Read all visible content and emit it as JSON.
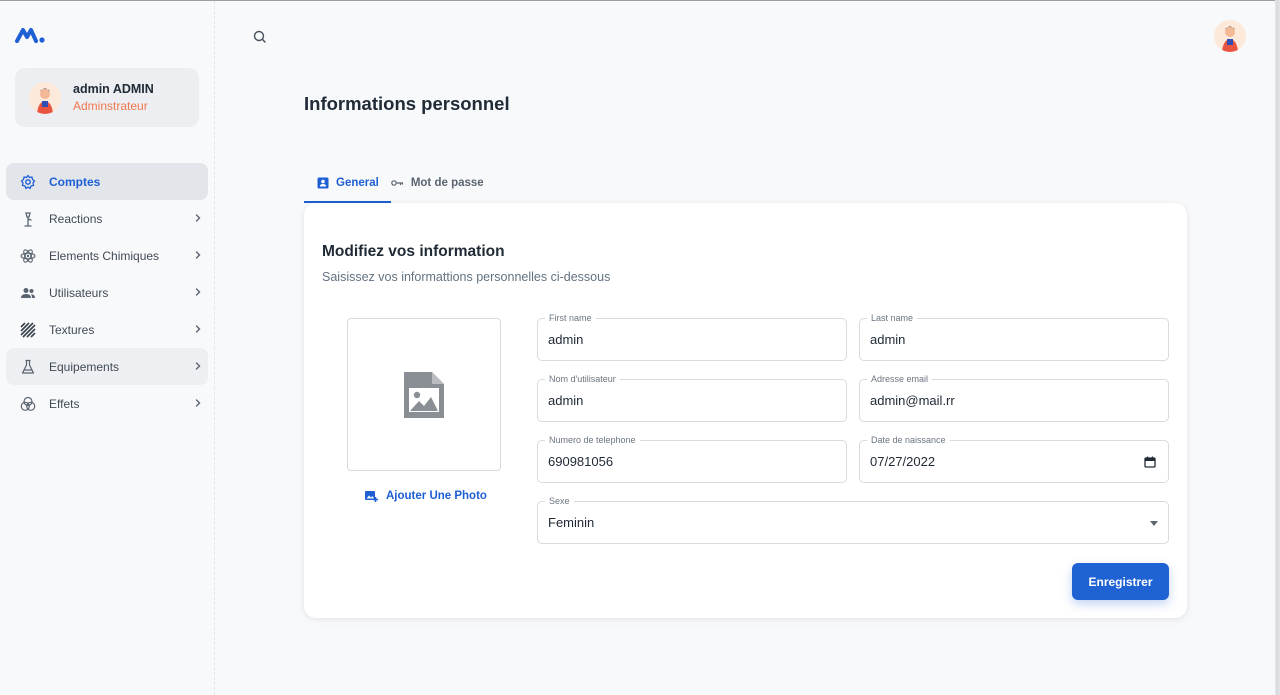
{
  "colors": {
    "accent": "#1e5fd4",
    "role_text": "#f0774e",
    "avatar_bg": "#fde9d9"
  },
  "brand": {
    "logo_icon": "brand-logo-icon"
  },
  "user": {
    "name": "admin ADMIN",
    "role": "Adminstrateur"
  },
  "sidebar": {
    "items": [
      {
        "label": "Comptes",
        "icon": "flower-gear-icon",
        "active": true
      },
      {
        "label": "Reactions",
        "icon": "flask-stand-icon"
      },
      {
        "label": "Elements Chimiques",
        "icon": "atom-icon"
      },
      {
        "label": "Utilisateurs",
        "icon": "users-icon"
      },
      {
        "label": "Textures",
        "icon": "stripes-icon"
      },
      {
        "label": "Equipements",
        "icon": "beaker-icon"
      },
      {
        "label": "Effets",
        "icon": "circles-icon"
      }
    ]
  },
  "header": {
    "search_icon": "search-icon"
  },
  "page": {
    "title": "Informations personnel"
  },
  "tabs": [
    {
      "label": "General",
      "icon": "contact-card-icon",
      "active": true
    },
    {
      "label": "Mot de passe",
      "icon": "key-icon"
    }
  ],
  "form": {
    "title": "Modifiez vos information",
    "subtitle": "Saisissez vos informattions personnelles ci-dessous",
    "add_photo_label": "Ajouter Une Photo",
    "fields": {
      "first_name": {
        "label": "First name",
        "value": "admin"
      },
      "last_name": {
        "label": "Last name",
        "value": "admin"
      },
      "username": {
        "label": "Nom d'utilisateur",
        "value": "admin"
      },
      "email": {
        "label": "Adresse email",
        "value": "admin@mail.rr"
      },
      "phone": {
        "label": "Numero de telephone",
        "value": "690981056"
      },
      "birthdate": {
        "label": "Date de naissance",
        "value": "07/27/2022"
      },
      "sex": {
        "label": "Sexe",
        "value": "Feminin"
      }
    },
    "save_label": "Enregistrer"
  }
}
